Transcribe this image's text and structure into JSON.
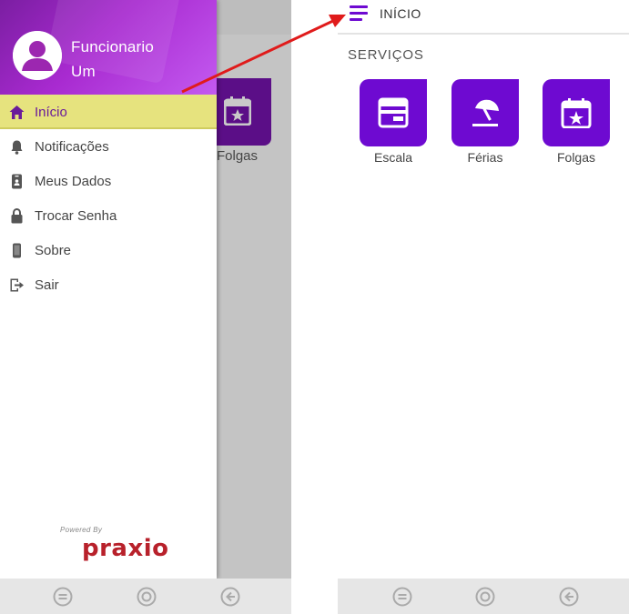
{
  "left_phone": {
    "background_tile_label": "Folgas",
    "drawer": {
      "user_name_line1": "Funcionario",
      "user_name_line2": "Um",
      "items": [
        {
          "label": "Início",
          "icon": "home-icon",
          "active": true
        },
        {
          "label": "Notificações",
          "icon": "bell-icon",
          "active": false
        },
        {
          "label": "Meus Dados",
          "icon": "id-card-icon",
          "active": false
        },
        {
          "label": "Trocar Senha",
          "icon": "lock-icon",
          "active": false
        },
        {
          "label": "Sobre",
          "icon": "phone-icon",
          "active": false
        },
        {
          "label": "Sair",
          "icon": "logout-icon",
          "active": false
        }
      ],
      "powered_by": "Powered By",
      "brand": "praxio"
    }
  },
  "right_phone": {
    "title": "INÍCIO",
    "section_title": "SERVIÇOS",
    "services": [
      {
        "label": "Escala",
        "icon": "schedule-icon"
      },
      {
        "label": "Férias",
        "icon": "beach-umbrella-icon"
      },
      {
        "label": "Folgas",
        "icon": "calendar-star-icon"
      }
    ]
  },
  "colors": {
    "accent_purple": "#6e0ad1",
    "header_gradient_start": "#7b1ea2",
    "active_item_bg": "#e6e37e",
    "brand_red": "#b8212b",
    "annotation_red": "#e01b1b"
  }
}
